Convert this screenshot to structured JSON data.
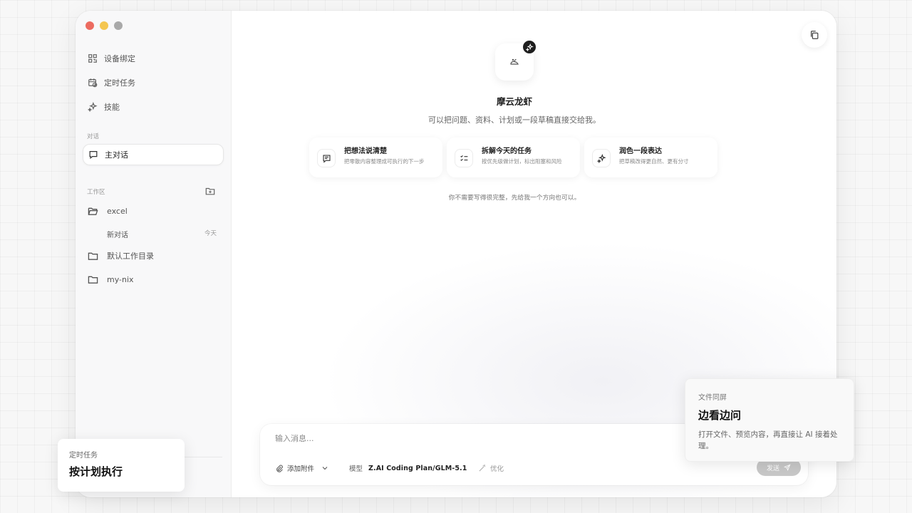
{
  "sidebar": {
    "nav": [
      {
        "label": "设备绑定",
        "icon": "qrcode-icon"
      },
      {
        "label": "定时任务",
        "icon": "calendar-clock-icon"
      },
      {
        "label": "技能",
        "icon": "sparkles-icon"
      }
    ],
    "chat_section_label": "对话",
    "active_chat": "主对话",
    "workspace_section_label": "工作区",
    "workspaces": [
      {
        "name": "excel",
        "icon": "folder-open-icon"
      },
      {
        "name": "默认工作目录",
        "icon": "folder-icon"
      },
      {
        "name": "my-nix",
        "icon": "folder-icon"
      }
    ],
    "sub_chat": {
      "label": "新对话",
      "date": "今天"
    }
  },
  "main": {
    "title": "摩云龙虾",
    "subtitle": "可以把问题、资料、计划或一段草稿直接交给我。",
    "cards": [
      {
        "title": "把想法说清楚",
        "desc": "把零散内容整理成可执行的下一步",
        "icon": "message-icon"
      },
      {
        "title": "拆解今天的任务",
        "desc": "按优先级做计划，标出阻塞和风险",
        "icon": "checklist-icon"
      },
      {
        "title": "润色一段表达",
        "desc": "把草稿改得更自然、更有分寸",
        "icon": "sparkles-icon"
      }
    ],
    "hint": "你不需要写得很完整，先给我一个方向也可以。"
  },
  "composer": {
    "placeholder": "输入消息...",
    "attach_label": "添加附件",
    "model_label": "模型",
    "model_value": "Z.AI Coding Plan/GLM-5.1",
    "optimize_label": "优化",
    "send_label": "发送"
  },
  "overlays": {
    "left": {
      "label": "定时任务",
      "title": "按计划执行"
    },
    "right": {
      "label": "文件同屏",
      "title": "边看边问",
      "desc": "打开文件、预览内容，再直接让 AI 接着处理。"
    }
  }
}
